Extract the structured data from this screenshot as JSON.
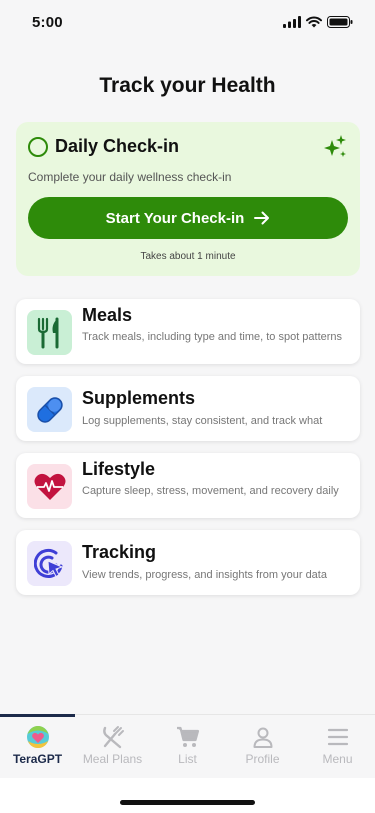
{
  "status_bar": {
    "time": "5:00"
  },
  "page": {
    "title": "Track your Health"
  },
  "checkin": {
    "title": "Daily Check-in",
    "description": "Complete your daily wellness check-in",
    "button_label": "Start Your Check-in",
    "note": "Takes about 1 minute",
    "accent_color": "#2e8b0a",
    "background_color": "#e9f8de"
  },
  "features": [
    {
      "title": "Meals",
      "description": "Track meals, including type and time, to spot patterns",
      "icon": "utensils-icon"
    },
    {
      "title": "Supplements",
      "description": "Log supplements, stay consistent, and track what",
      "icon": "pill-icon"
    },
    {
      "title": "Lifestyle",
      "description": "Capture sleep, stress, movement, and recovery daily",
      "icon": "heart-pulse-icon"
    },
    {
      "title": "Tracking",
      "description": "View trends, progress, and insights from your data",
      "icon": "target-cursor-icon"
    }
  ],
  "nav": {
    "items": [
      {
        "label": "TeraGPT",
        "icon": "teragpt-logo-icon",
        "active": true
      },
      {
        "label": "Meal Plans",
        "icon": "utensils-cross-icon",
        "active": false
      },
      {
        "label": "List",
        "icon": "cart-icon",
        "active": false
      },
      {
        "label": "Profile",
        "icon": "user-icon",
        "active": false
      },
      {
        "label": "Menu",
        "icon": "hamburger-icon",
        "active": false
      }
    ]
  }
}
